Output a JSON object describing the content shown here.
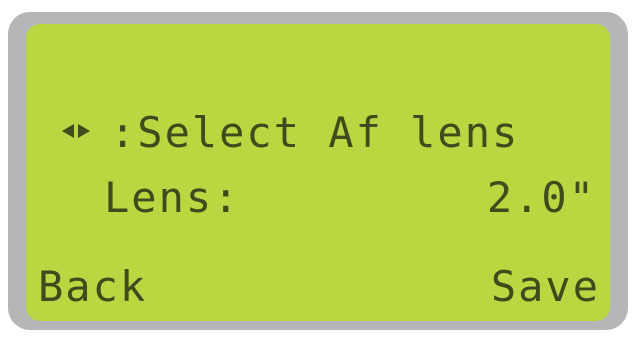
{
  "display": {
    "line1_text": ":Select Af lens",
    "lens_label": "Lens:",
    "lens_value": "2.0\"",
    "back_label": "Back",
    "save_label": "Save"
  },
  "icons": {
    "nav_arrows": "left-right-arrows-icon"
  },
  "colors": {
    "lcd_background": "#bad640",
    "lcd_text": "#3f4a1d",
    "bezel": "#b5b6b8"
  }
}
